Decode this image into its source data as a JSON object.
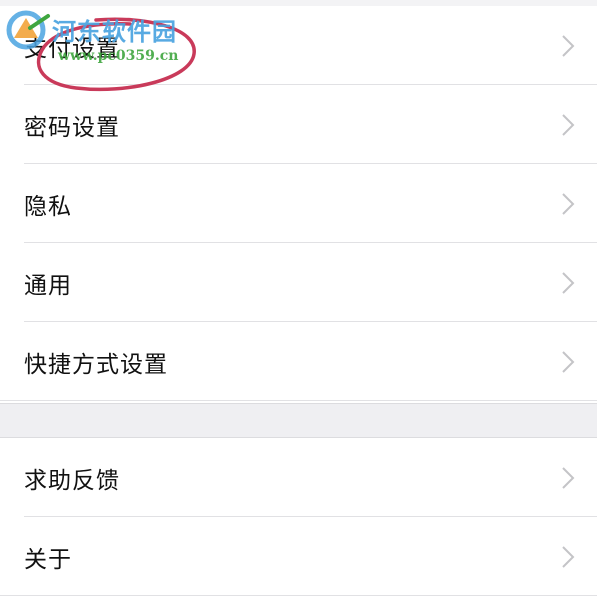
{
  "groups": [
    {
      "items": [
        {
          "label": "支付设置",
          "visible_label": "付设置"
        },
        {
          "label": "密码设置"
        },
        {
          "label": "隐私"
        },
        {
          "label": "通用"
        },
        {
          "label": "快捷方式设置"
        }
      ]
    },
    {
      "items": [
        {
          "label": "求助反馈"
        },
        {
          "label": "关于"
        }
      ]
    }
  ],
  "watermark": {
    "title": "河东软件园",
    "url": "www.pc0359.cn"
  },
  "colors": {
    "background": "#f3f3f5",
    "row": "#ffffff",
    "chevron": "#c4c4c7",
    "annotation": "#c93a5a",
    "watermark_blue": "#4aa3e0",
    "watermark_green": "#3fa63f"
  }
}
